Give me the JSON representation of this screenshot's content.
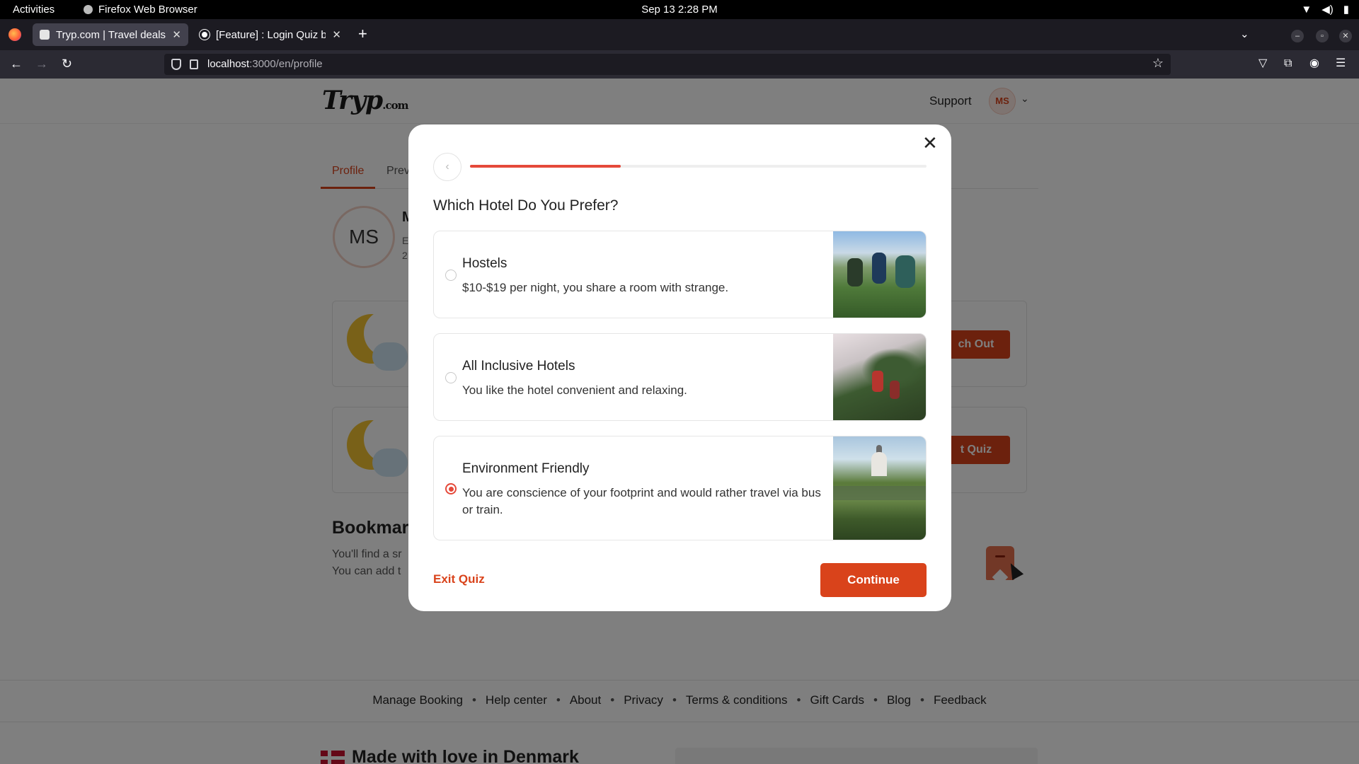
{
  "system_bar": {
    "activities": "Activities",
    "app_name": "Firefox Web Browser",
    "clock": "Sep 13  2:28 PM",
    "tray_icons": [
      "wifi-icon",
      "volume-icon",
      "battery-icon"
    ]
  },
  "browser": {
    "tabs": [
      {
        "title": "Tryp.com | Travel deals in",
        "active": true,
        "icon": "tryp-favicon-icon"
      },
      {
        "title": "[Feature] : Login Quiz by",
        "active": false,
        "icon": "github-favicon-icon"
      }
    ],
    "new_tab": "+",
    "url_host": "localhost",
    "url_rest": ":3000/en/profile"
  },
  "site": {
    "logo_main": "Tryp",
    "logo_suffix": ".com",
    "support": "Support",
    "avatar_initials": "MS",
    "profile_tabs": [
      "Profile",
      "Prev"
    ],
    "profile_avatar": "MS",
    "name_fragment": "M",
    "info_line_1": "E",
    "info_line_2": "2",
    "card_buttons": [
      "ch Out",
      "t Quiz"
    ],
    "bookmarks_title": "Bookmar",
    "bookmarks_line_1": "You'll find a sr",
    "bookmarks_line_2": "You can add t",
    "footer_links": [
      "Manage Booking",
      "Help center",
      "About",
      "Privacy",
      "Terms & conditions",
      "Gift Cards",
      "Blog",
      "Feedback"
    ],
    "made_with_love": "Made with love in Denmark"
  },
  "quiz": {
    "question": "Which Hotel Do You Prefer?",
    "progress": 0.33,
    "options": [
      {
        "title": "Hostels",
        "description": "$10-$19 per night, you share a room with strange.",
        "selected": false
      },
      {
        "title": "All Inclusive Hotels",
        "description": "You like the hotel convenient and relaxing.",
        "selected": false
      },
      {
        "title": "Environment Friendly",
        "description": "You are conscience of your footprint and would rather travel via bus or train.",
        "selected": true
      }
    ],
    "exit_label": "Exit Quiz",
    "continue_label": "Continue",
    "close_icon": "close-icon",
    "back_icon": "chevron-left-icon"
  },
  "colors": {
    "brand": "#d9431b",
    "progress": "#e5493a"
  }
}
